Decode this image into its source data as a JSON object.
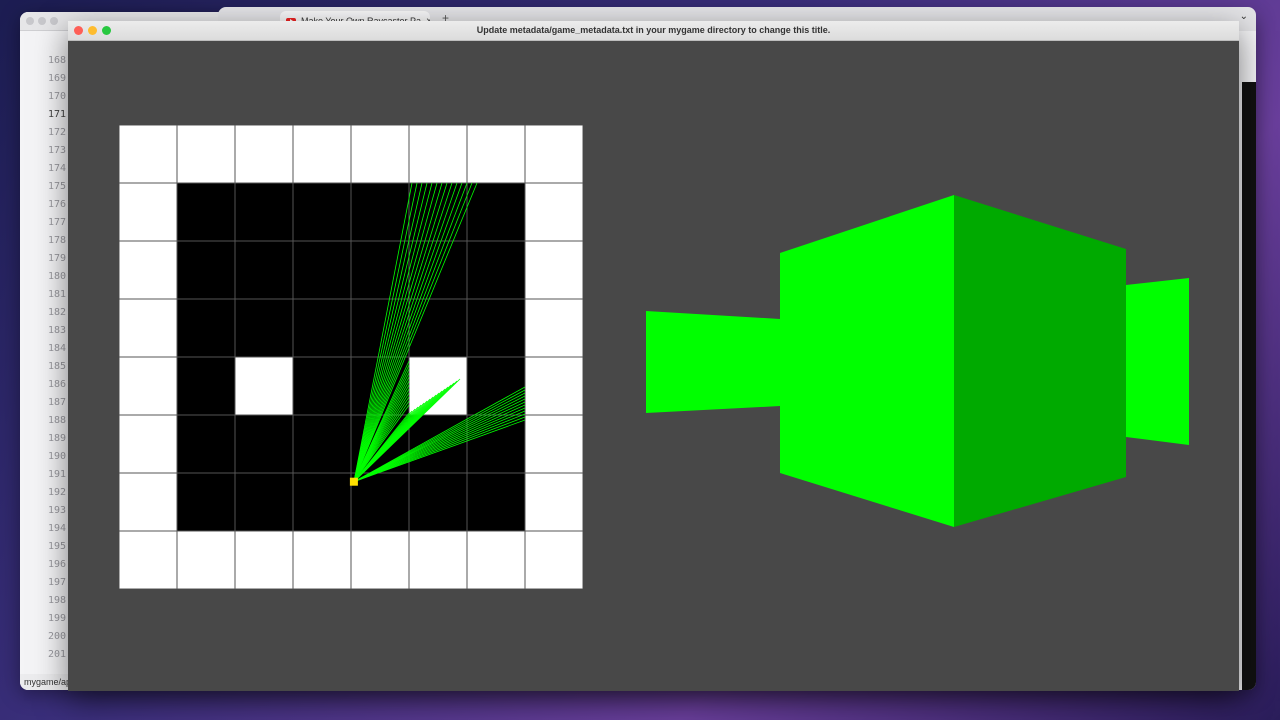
{
  "editor": {
    "line_numbers": [
      "168",
      "169",
      "170",
      "171",
      "172",
      "173",
      "174",
      "175",
      "176",
      "177",
      "178",
      "179",
      "180",
      "181",
      "182",
      "183",
      "184",
      "185",
      "186",
      "187",
      "188",
      "189",
      "190",
      "191",
      "192",
      "193",
      "194",
      "195",
      "196",
      "197",
      "198",
      "199",
      "200",
      "201"
    ],
    "active_line": "171",
    "status_path": "mygame/ap"
  },
  "browser": {
    "tab_title": "Make Your Own Raycaster Pa",
    "tab_close": "×",
    "new_tab": "+",
    "menu_chevron": "⌄"
  },
  "game_window": {
    "title": "Update metadata/game_metadata.txt in your mygame directory to change this title."
  },
  "map": {
    "grid": [
      [
        1,
        1,
        1,
        1,
        1,
        1,
        1,
        1
      ],
      [
        1,
        0,
        0,
        0,
        0,
        0,
        0,
        1
      ],
      [
        1,
        0,
        0,
        0,
        0,
        0,
        0,
        1
      ],
      [
        1,
        0,
        0,
        0,
        0,
        0,
        0,
        1
      ],
      [
        1,
        0,
        1,
        0,
        0,
        1,
        0,
        1
      ],
      [
        1,
        0,
        0,
        0,
        0,
        0,
        0,
        1
      ],
      [
        1,
        0,
        0,
        0,
        0,
        0,
        0,
        1
      ],
      [
        1,
        1,
        1,
        1,
        1,
        1,
        1,
        1
      ]
    ],
    "player_cell": [
      4.05,
      6.15
    ],
    "colors": {
      "wall": "#ffffff",
      "floor": "#000000",
      "grid_line": "#555555",
      "ray": "#00ff00",
      "player": "#ffe000"
    }
  },
  "view3d": {
    "colors": {
      "wall_lit": "#00ff00",
      "wall_shade": "#00aa00",
      "background": "#484848"
    }
  }
}
